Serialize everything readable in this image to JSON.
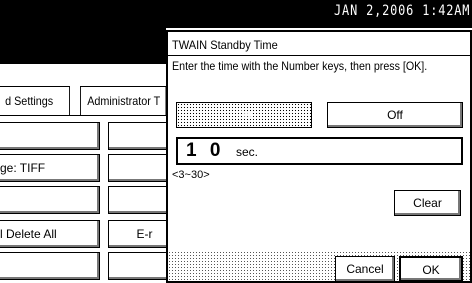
{
  "status_bar": {
    "datetime": "JAN   2,2006  1:42AM"
  },
  "background": {
    "tabs": [
      {
        "label": "d Settings"
      },
      {
        "label": "Administrator T"
      }
    ],
    "rows": [
      {
        "left": "",
        "right": ""
      },
      {
        "left": "ge: TIFF",
        "right": ""
      },
      {
        "left": "",
        "right": ""
      },
      {
        "left": "l Delete All",
        "right": "E-r"
      },
      {
        "left": "",
        "right": ""
      }
    ]
  },
  "dialog": {
    "title": "TWAIN Standby Time",
    "instruction": "Enter the time with the Number keys, then press [OK].",
    "options": {
      "on_label": "On",
      "off_label": "Off",
      "selected": "On"
    },
    "value": {
      "number": "1 0",
      "unit": "sec.",
      "range": "<3~30>"
    },
    "clear_label": "Clear",
    "cancel_label": "Cancel",
    "ok_label": "OK"
  }
}
